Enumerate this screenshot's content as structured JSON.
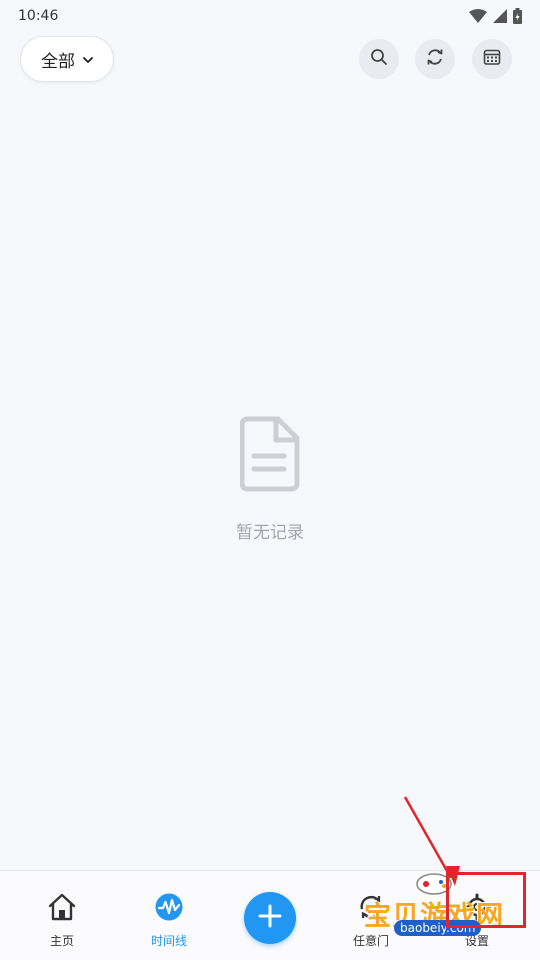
{
  "status_bar": {
    "time": "10:46"
  },
  "header": {
    "filter_label": "全部"
  },
  "empty_state": {
    "message": "暂无记录"
  },
  "bottom_nav": {
    "items": [
      {
        "label": "主页",
        "icon": "home-icon",
        "active": false
      },
      {
        "label": "时间线",
        "icon": "timeline-icon",
        "active": true
      },
      {
        "label": "任意门",
        "icon": "portal-icon",
        "active": false
      },
      {
        "label": "设置",
        "icon": "settings-icon",
        "active": false
      }
    ],
    "add_icon": "plus-icon"
  },
  "watermark": {
    "brand": "宝贝游戏网",
    "url": "baobeiy.com"
  },
  "colors": {
    "accent": "#2196f3",
    "background": "#f7f8fc",
    "annotation": "#e0262b",
    "watermark": "#f5a623"
  }
}
